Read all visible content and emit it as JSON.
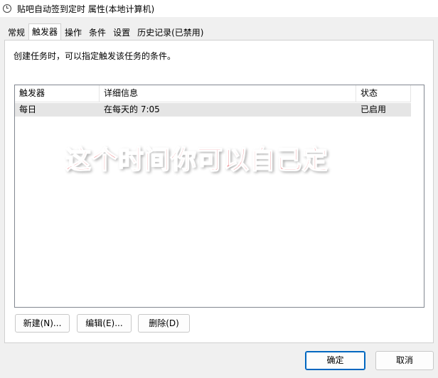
{
  "window": {
    "title": "贴吧自动签到定时 属性(本地计算机)",
    "icon": "clock-icon"
  },
  "tabs": [
    {
      "label": "常规",
      "active": false
    },
    {
      "label": "触发器",
      "active": true
    },
    {
      "label": "操作",
      "active": false
    },
    {
      "label": "条件",
      "active": false
    },
    {
      "label": "设置",
      "active": false
    },
    {
      "label": "历史记录(已禁用)",
      "active": false
    }
  ],
  "triggers_tab": {
    "instruction": "创建任务时，可以指定触发该任务的条件。",
    "columns": [
      "触发器",
      "详细信息",
      "状态"
    ],
    "rows": [
      {
        "trigger": "每日",
        "details": "在每天的 7:05",
        "status": "已启用"
      }
    ],
    "new_button": "新建(N)...",
    "edit_button": "编辑(E)...",
    "delete_button": "删除(D)"
  },
  "annotation": {
    "text": "这个时间你可以自己定",
    "color": "#e0202a"
  },
  "footer": {
    "ok_button": "确定",
    "cancel_button": "取消"
  }
}
